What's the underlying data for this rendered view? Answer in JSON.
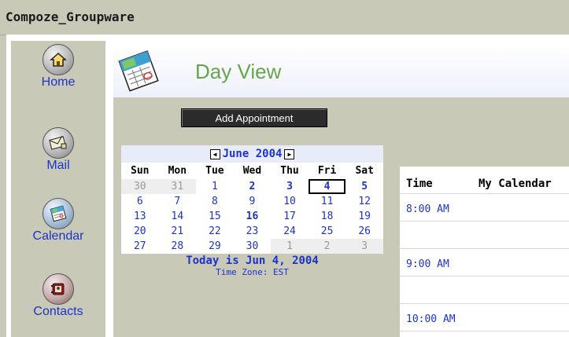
{
  "app": {
    "title": "Compoze_Groupware"
  },
  "sidebar": {
    "items": [
      {
        "label": "Home",
        "icon": "home-icon"
      },
      {
        "label": "Mail",
        "icon": "mail-icon"
      },
      {
        "label": "Calendar",
        "icon": "calendar-icon"
      },
      {
        "label": "Contacts",
        "icon": "contacts-icon"
      }
    ]
  },
  "header": {
    "title": "Day View",
    "icon": "calendar-icon"
  },
  "toolbar": {
    "add_label": "Add Appointment"
  },
  "calendar": {
    "month_label": "June 2004",
    "prev_icon": "triangle-left-icon",
    "next_icon": "triangle-right-icon",
    "weekdays": [
      "Sun",
      "Mon",
      "Tue",
      "Wed",
      "Thu",
      "Fri",
      "Sat"
    ],
    "weeks": [
      [
        "30",
        "31",
        "1",
        "2",
        "3",
        "4",
        "5"
      ],
      [
        "6",
        "7",
        "8",
        "9",
        "10",
        "11",
        "12"
      ],
      [
        "13",
        "14",
        "15",
        "16",
        "17",
        "18",
        "19"
      ],
      [
        "20",
        "21",
        "22",
        "23",
        "24",
        "25",
        "26"
      ],
      [
        "27",
        "28",
        "29",
        "30",
        "1",
        "2",
        "3"
      ]
    ],
    "today_text": "Today is Jun 4, 2004",
    "timezone_text": "Time Zone: EST",
    "colors": {
      "link": "#1c33cc",
      "other_month_bg": "#eeeeee",
      "other_month_text": "#999999"
    }
  },
  "dayview": {
    "col_time": "Time",
    "col_calendar": "My Calendar",
    "slots": [
      "8:00 AM",
      "",
      "9:00 AM",
      "",
      "10:00 AM"
    ]
  },
  "colors": {
    "background": "#c9c9b7",
    "header_title": "#66a64a",
    "button": "#2b2b2b"
  }
}
